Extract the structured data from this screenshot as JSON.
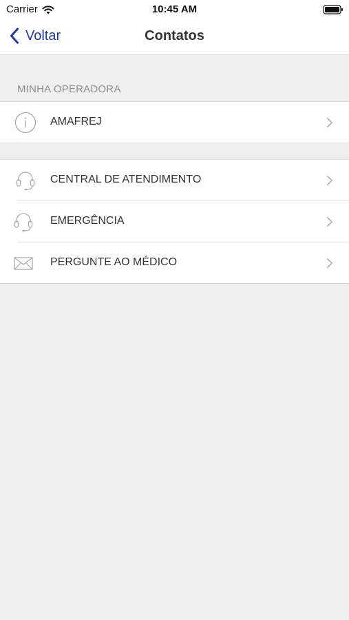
{
  "status_bar": {
    "carrier": "Carrier",
    "time": "10:45 AM"
  },
  "nav": {
    "back_label": "Voltar",
    "title": "Contatos"
  },
  "section": {
    "header": "MINHA OPERADORA"
  },
  "group_1": [
    {
      "label": "AMAFREJ",
      "icon": "info-icon"
    }
  ],
  "group_2": [
    {
      "label": "CENTRAL DE ATENDIMENTO",
      "icon": "headset-icon"
    },
    {
      "label": "EMERGÊNCIA",
      "icon": "headset-icon"
    },
    {
      "label": "PERGUNTE AO MÉDICO",
      "icon": "envelope-icon"
    }
  ],
  "colors": {
    "accent": "#1f3a8f",
    "background": "#efefef",
    "icon_gray": "#aaaaaa"
  }
}
